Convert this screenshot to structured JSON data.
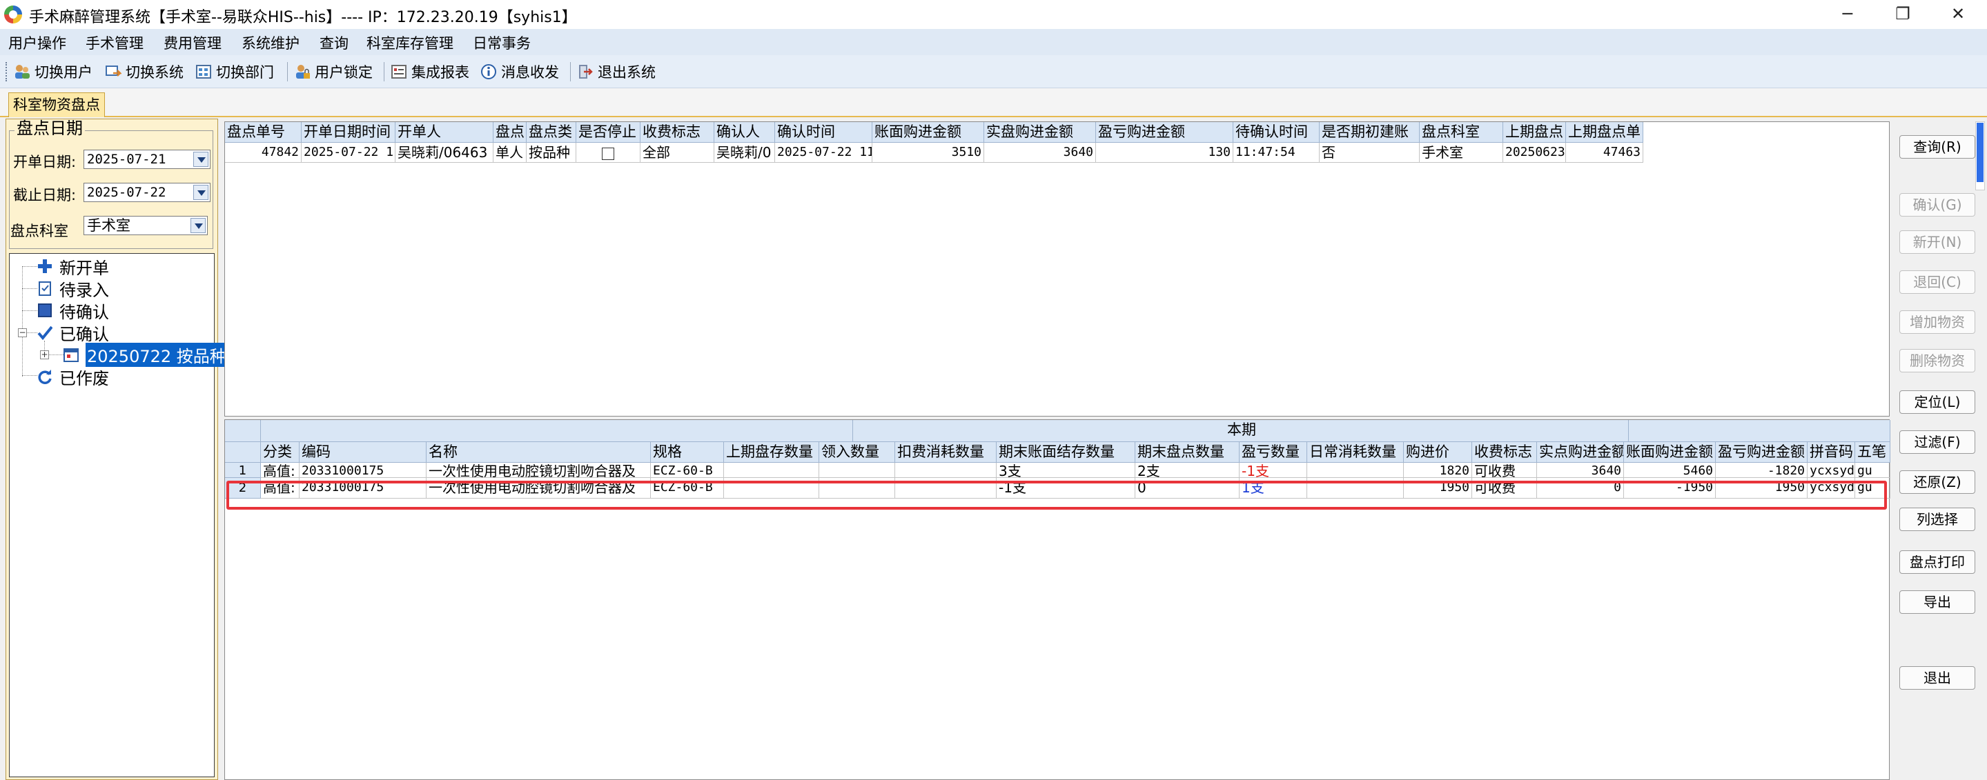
{
  "window": {
    "title": "手术麻醉管理系统【手术室--易联众HIS--his】---- IP：172.23.20.19【syhis1】",
    "min_label": "─",
    "max_label": "❐",
    "close_label": "✕"
  },
  "menu": [
    "用户操作",
    "手术管理",
    "费用管理",
    "系统维护",
    "查询",
    "科室库存管理",
    "日常事务"
  ],
  "toolbar": [
    "切换用户",
    "切换系统",
    "切换部门",
    "用户锁定",
    "集成报表",
    "消息收发",
    "退出系统"
  ],
  "tab": {
    "label": "科室物资盘点"
  },
  "left": {
    "group_title": "盘点日期",
    "start_label": "开单日期:",
    "start_value": "2025-07-21",
    "end_label": "截止日期:",
    "end_value": "2025-07-22",
    "dept_label": "盘点科室",
    "dept_value": "手术室",
    "tree": {
      "new": "新开单",
      "pending_entry": "待录入",
      "pending_confirm": "待确认",
      "confirmed": "已确认",
      "child": "20250722 按品种",
      "voided": "已作废"
    }
  },
  "grid1": {
    "headers": [
      "盘点单号",
      "开单日期时间",
      "开单人",
      "盘点",
      "盘点类",
      "是否停止",
      "收费标志",
      "确认人",
      "确认时间",
      "账面购进金额",
      "实盘购进金额",
      "盈亏购进金额",
      "待确认时间",
      "是否期初建账",
      "盘点科室",
      "上期盘点",
      "上期盘点单"
    ],
    "row": [
      "47842",
      "2025-07-22 1",
      "吴晓莉/06463",
      "单人",
      "按品种",
      "",
      "全部",
      "吴晓莉/0",
      "2025-07-22 11",
      "3510",
      "3640",
      "130",
      "11:47:54",
      "否",
      "手术室",
      "20250623",
      "47463"
    ]
  },
  "grid2": {
    "group_header": "本期",
    "headers": [
      "分类",
      "编码",
      "名称",
      "规格",
      "上期盘存数量",
      "领入数量",
      "扣费消耗数量",
      "期末账面结存数量",
      "期末盘点数量",
      "盈亏数量",
      "日常消耗数量",
      "购进价",
      "收费标志",
      "实点购进金额",
      "账面购进金额",
      "盈亏购进金额",
      "拼音码",
      "五笔"
    ],
    "rows": [
      {
        "no": "1",
        "cells": [
          "高值:",
          "20331000175",
          "一次性使用电动腔镜切割吻合器及",
          "ECZ-60-B",
          "",
          "",
          "",
          "3支",
          "2支",
          "-1支",
          "",
          "1820",
          "可收费",
          "3640",
          "5460",
          "-1820",
          "ycxsyd",
          "gu"
        ]
      },
      {
        "no": "2",
        "cells": [
          "高值:",
          "20331000175",
          "一次性使用电动腔镜切割吻合器及",
          "ECZ-60-B",
          "",
          "",
          "",
          "-1支",
          "0",
          "1支",
          "",
          "1950",
          "可收费",
          "0",
          "-1950",
          "1950",
          "ycxsyd",
          "gu"
        ]
      }
    ]
  },
  "buttons": [
    "查询(R)",
    "确认(G)",
    "新开(N)",
    "退回(C)",
    "增加物资",
    "删除物资",
    "定位(L)",
    "过滤(F)",
    "还原(Z)",
    "列选择",
    "盘点打印",
    "导出",
    "退出"
  ],
  "colors": {
    "highlight": "#e8343a",
    "accent": "#0a63c9",
    "negative": "#e0201a",
    "positive": "#1a3cd6"
  }
}
